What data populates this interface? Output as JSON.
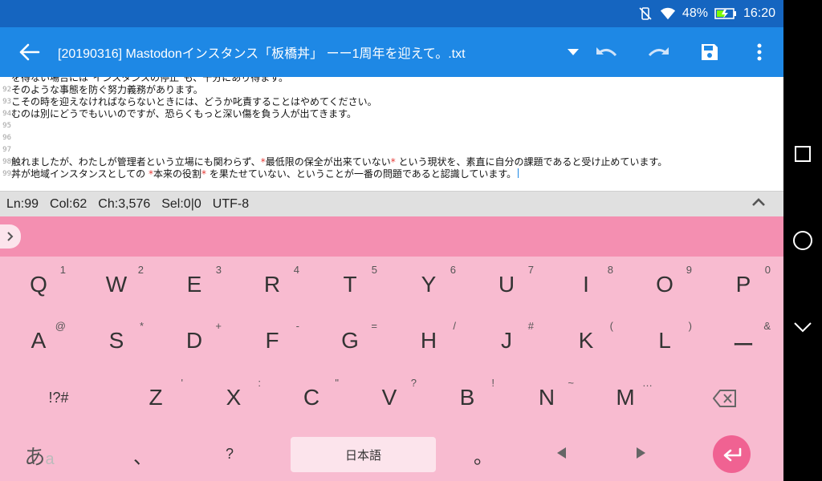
{
  "status": {
    "battery": "48%",
    "time": "16:20"
  },
  "toolbar": {
    "title": "[20190316] Mastodonインスタンス「板橋丼」 ーー1周年を迎えて。.txt"
  },
  "editor": {
    "lines": [
      {
        "num": "",
        "text": "を得ない場合には\"インスタンスの停止\"も、十分にあり得ます。"
      },
      {
        "num": "92",
        "text": "そのような事態を防ぐ努力義務があります。"
      },
      {
        "num": "93",
        "text": "こその時を迎えなければならないときには、どうか叱責することはやめてください。"
      },
      {
        "num": "94",
        "text": "むのは別にどうでもいいのですが、恐らくもっと深い傷を負う人が出てきます。"
      },
      {
        "num": "95",
        "text": ""
      },
      {
        "num": "96",
        "text": ""
      },
      {
        "num": "97",
        "text": ""
      },
      {
        "num": "98",
        "pre": "触れましたが、わたしが管理者という立場にも関わらず、",
        "mark1": "*",
        "mid": "最低限の保全が出来ていない",
        "mark2": "*",
        "post": " という現状を、素直に自分の課題であると受け止めています。"
      },
      {
        "num": "99",
        "pre": "丼が地域インスタンスとしての ",
        "mark1": "*",
        "mid": "本来の役割",
        "mark2": "*",
        "post": " を果たせていない、ということが一番の問題であると認識しています。"
      }
    ]
  },
  "infobar": {
    "ln": "Ln:99",
    "col": "Col:62",
    "ch": "Ch:3,576",
    "sel": "Sel:0|0",
    "enc": "UTF-8"
  },
  "keyboard": {
    "row1": [
      {
        "main": "Q",
        "sub": "1"
      },
      {
        "main": "W",
        "sub": "2"
      },
      {
        "main": "E",
        "sub": "3"
      },
      {
        "main": "R",
        "sub": "4"
      },
      {
        "main": "T",
        "sub": "5"
      },
      {
        "main": "Y",
        "sub": "6"
      },
      {
        "main": "U",
        "sub": "7"
      },
      {
        "main": "I",
        "sub": "8"
      },
      {
        "main": "O",
        "sub": "9"
      },
      {
        "main": "P",
        "sub": "0"
      }
    ],
    "row2": [
      {
        "main": "A",
        "sub": "@"
      },
      {
        "main": "S",
        "sub": "*"
      },
      {
        "main": "D",
        "sub": "+"
      },
      {
        "main": "F",
        "sub": "-"
      },
      {
        "main": "G",
        "sub": "="
      },
      {
        "main": "H",
        "sub": "/"
      },
      {
        "main": "J",
        "sub": "#"
      },
      {
        "main": "K",
        "sub": "("
      },
      {
        "main": "L",
        "sub": ")"
      },
      {
        "main": "ー",
        "sub": "&"
      }
    ],
    "row3": [
      {
        "main": "!?#",
        "sub": ""
      },
      {
        "main": "Z",
        "sub": "'"
      },
      {
        "main": "X",
        "sub": ":"
      },
      {
        "main": "C",
        "sub": "\""
      },
      {
        "main": "V",
        "sub": "?"
      },
      {
        "main": "B",
        "sub": "!"
      },
      {
        "main": "N",
        "sub": "~"
      },
      {
        "main": "M",
        "sub": "…"
      }
    ],
    "row4": {
      "kana": "あ",
      "kana_sub": "a",
      "comma": "、",
      "question": "?",
      "space": "日本語",
      "period": "。"
    }
  }
}
